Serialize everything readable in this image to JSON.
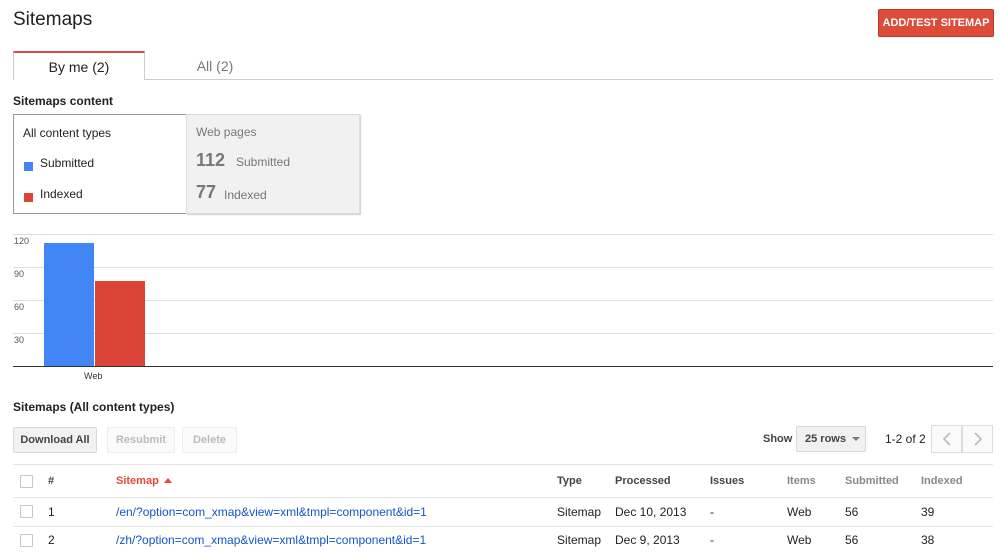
{
  "header": {
    "title": "Sitemaps",
    "add_button": "ADD/TEST SITEMAP"
  },
  "tabs": [
    {
      "label": "By me (2)",
      "active": true
    },
    {
      "label": "All (2)",
      "active": false
    }
  ],
  "content_section": {
    "heading": "Sitemaps content",
    "all_types": {
      "title": "All content types",
      "legend": [
        {
          "label": "Submitted",
          "color": "#4285f4"
        },
        {
          "label": "Indexed",
          "color": "#db4437"
        }
      ]
    },
    "web_pages": {
      "title": "Web pages",
      "submitted_count": "112",
      "submitted_label": "Submitted",
      "indexed_count": "77",
      "indexed_label": "Indexed"
    }
  },
  "chart_data": {
    "type": "bar",
    "categories": [
      "Web"
    ],
    "series": [
      {
        "name": "Submitted",
        "values": [
          112
        ],
        "color": "#4285f4"
      },
      {
        "name": "Indexed",
        "values": [
          77
        ],
        "color": "#db4437"
      }
    ],
    "yticks": [
      "120",
      "90",
      "60",
      "30"
    ],
    "ylim": [
      0,
      120
    ],
    "grid": true
  },
  "table_section": {
    "heading": "Sitemaps (All content types)",
    "buttons": {
      "download": "Download All",
      "resubmit": "Resubmit",
      "delete": "Delete"
    },
    "show_label": "Show",
    "rows_option": "25 rows",
    "pager_text": "1-2 of 2"
  },
  "table": {
    "columns": [
      "#",
      "Sitemap",
      "Type",
      "Processed",
      "Issues",
      "Items",
      "Submitted",
      "Indexed"
    ],
    "rows": [
      {
        "num": "1",
        "sitemap": "/en/?option=com_xmap&view=xml&tmpl=component&id=1",
        "type": "Sitemap",
        "processed": "Dec 10, 2013",
        "issues": "-",
        "items": "Web",
        "submitted": "56",
        "indexed": "39"
      },
      {
        "num": "2",
        "sitemap": "/zh/?option=com_xmap&view=xml&tmpl=component&id=1",
        "type": "Sitemap",
        "processed": "Dec 9, 2013",
        "issues": "-",
        "items": "Web",
        "submitted": "56",
        "indexed": "38"
      }
    ]
  }
}
